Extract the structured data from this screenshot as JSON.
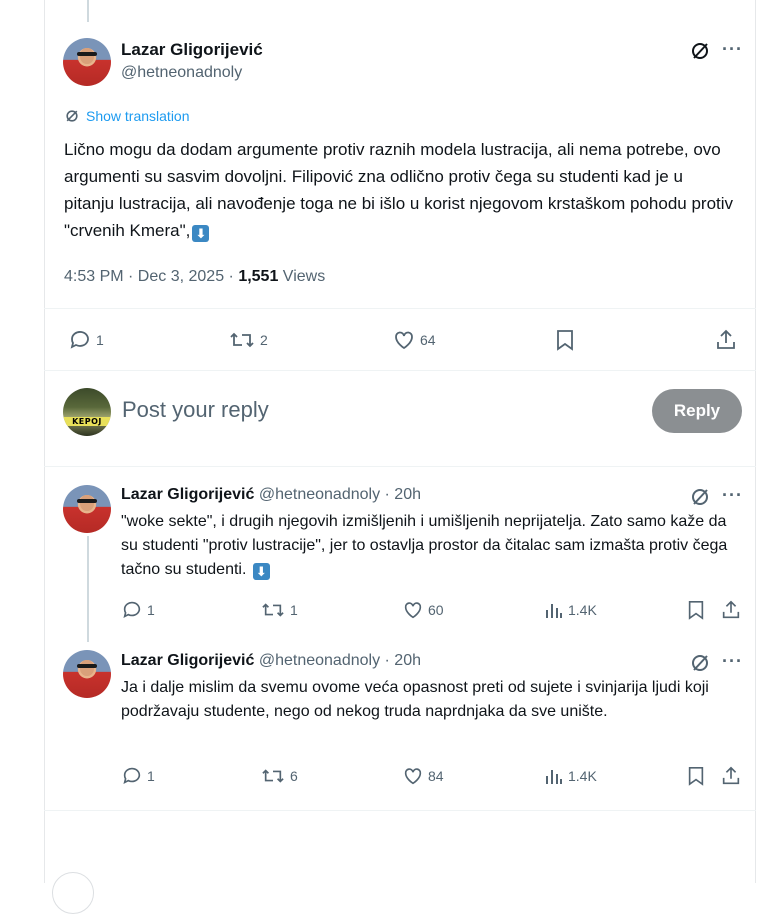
{
  "main_tweet": {
    "author_name": "Lazar Gligorijević",
    "author_handle": "@hetneonadnoly",
    "show_translation": "Show translation",
    "text": "Lično mogu da dodam argumente protiv raznih modela lustracija, ali nema potrebe, ovo argumenti su sasvim dovoljni. Filipović zna odlično protiv čega su studenti kad je u pitanju lustracija, ali navođenje toga ne bi išlo u korist njegovom krstaškom pohodu protiv \"crvenih Kmera\",",
    "time": "4:53 PM · Dec 3, 2025 · ",
    "views_count": "1,551",
    "views_label": " Views",
    "actions": {
      "replies": "1",
      "reposts": "2",
      "likes": "64"
    }
  },
  "reply_box": {
    "avatar_label": "KEPOJ",
    "placeholder": "Post your reply",
    "button_label": "Reply"
  },
  "replies": [
    {
      "author_name": "Lazar Gligorijević",
      "author_handle": "@hetneonadnoly · 20h",
      "text": "\"woke sekte\", i drugih njegovih izmišljenih i umišljenih neprijatelja. Zato samo kaže da su studenti \"protiv lustracije\", jer to ostavlja prostor da čitalac sam izmašta protiv čega tačno su studenti.",
      "actions": {
        "replies": "1",
        "reposts": "1",
        "likes": "60",
        "views": "1.4K"
      }
    },
    {
      "author_name": "Lazar Gligorijević",
      "author_handle": "@hetneonadnoly · 20h",
      "text": "Ja i dalje mislim da svemu ovome veća opasnost preti od sujete i svinjarija ljudi koji podržavaju studente, nego od nekog truda naprdnjaka da sve unište.",
      "actions": {
        "replies": "1",
        "reposts": "6",
        "likes": "84",
        "views": "1.4K"
      }
    }
  ],
  "icons": {
    "grok": "grok-icon",
    "more": "more-icon",
    "reply": "reply-icon",
    "repost": "repost-icon",
    "like": "heart-icon",
    "views": "views-icon",
    "bookmark": "bookmark-icon",
    "share": "share-icon",
    "arrow_emoji": "down-arrow-emoji-icon"
  },
  "colors": {
    "link": "#1d9bf0",
    "secondary": "#536471",
    "button_disabled": "#8b8f92"
  }
}
